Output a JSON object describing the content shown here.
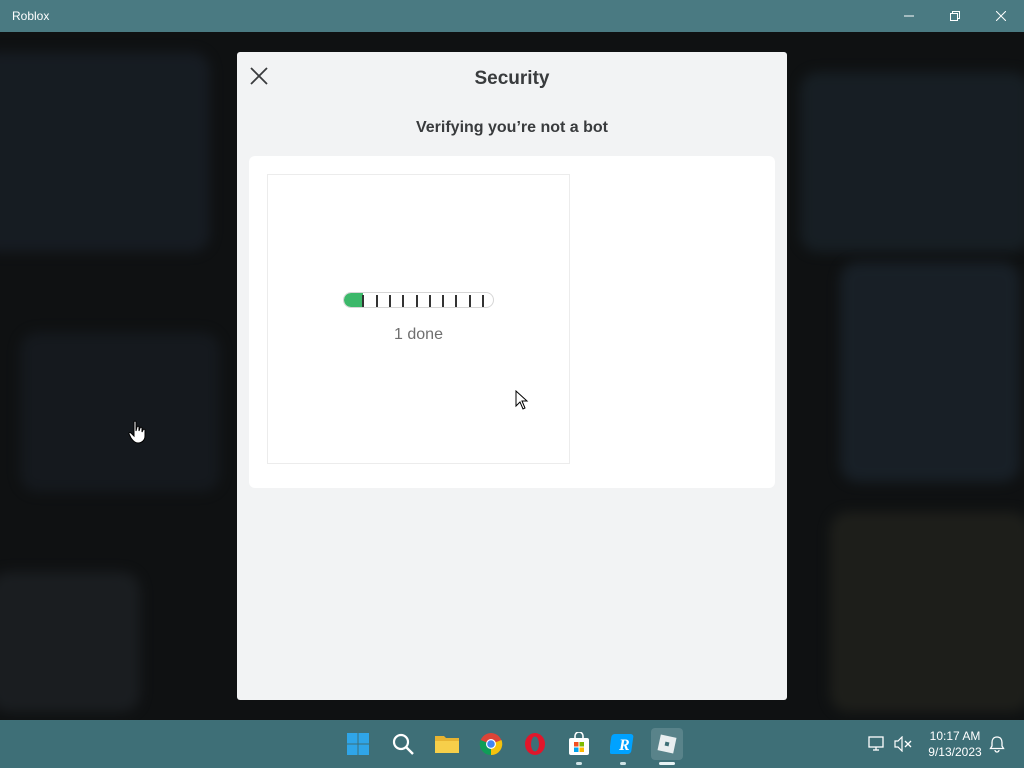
{
  "window": {
    "title": "Roblox"
  },
  "modal": {
    "title": "Security",
    "subtitle": "Verifying you’re not a bot",
    "progress": {
      "completed": 1,
      "total": 10,
      "label": "1 done"
    }
  },
  "taskbar": {
    "icons": [
      "windows-start-icon",
      "search-icon",
      "file-explorer-icon",
      "chrome-icon",
      "opera-icon",
      "microsoft-store-icon",
      "roblox-studio-icon",
      "roblox-player-icon"
    ],
    "clock": {
      "time": "10:17 AM",
      "date": "9/13/2023"
    }
  },
  "colors": {
    "titlebar": "#4a7a82",
    "taskbar": "#3e6f77",
    "progress_fill": "#3cb86a",
    "modal_bg": "#f2f3f4"
  }
}
